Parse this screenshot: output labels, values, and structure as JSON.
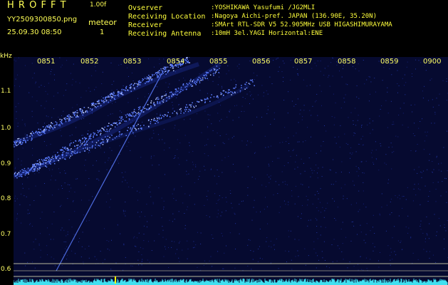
{
  "header": {
    "program_name": "H R O F F T",
    "version": "1.00f",
    "filename": "YY2509300850.png",
    "datetime": "25.09.30 08:50",
    "meteor_label": "meteor",
    "meteor_count": "1",
    "info": [
      {
        "label": "Ovserver",
        "value": ":YOSHIKAWA Yasufumi /JG2MLI"
      },
      {
        "label": "Receiving Location",
        "value": ":Nagoya Aichi-pref. JAPAN (136.90E, 35.20N)"
      },
      {
        "label": "Receiver",
        "value": ":SMArt RTL-SDR V5 52.905MHz USB HIGASHIMURAYAMA"
      },
      {
        "label": "Receiving Antenna",
        "value": ":10mH 3el.YAGI Horizontal:ENE"
      }
    ]
  },
  "axis": {
    "unit": "kHz",
    "freq_ticks": [
      "1.1",
      "1.0",
      "0.9",
      "0.8",
      "0.7",
      "0.6"
    ],
    "time_ticks": [
      "0851",
      "0852",
      "0853",
      "0854",
      "0855",
      "0856",
      "0857",
      "0858",
      "0859",
      "0900"
    ]
  },
  "colors": {
    "background": "#000000",
    "spectrogram_bg": "#060a30",
    "text": "#ffff55",
    "signal": "#5a7cff",
    "signal_bright": "#b8c8ff",
    "baseline": "#40e0f0",
    "marker_lines": "#d8d8b0",
    "meteor_mark": "#ffff00"
  }
}
